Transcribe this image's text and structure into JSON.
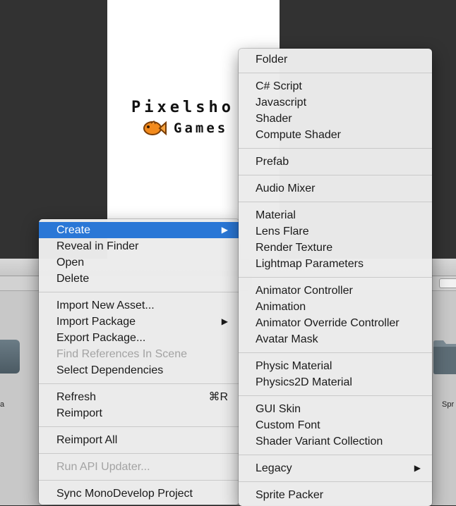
{
  "logo": {
    "line1": "Pixelsho",
    "line2": "Games"
  },
  "asset_labels": {
    "left": "a",
    "right": "Spr"
  },
  "context_menu": {
    "groups": [
      [
        {
          "label": "Create",
          "submenu": true,
          "highlighted": true
        },
        {
          "label": "Reveal in Finder"
        },
        {
          "label": "Open"
        },
        {
          "label": "Delete"
        }
      ],
      [
        {
          "label": "Import New Asset..."
        },
        {
          "label": "Import Package",
          "submenu": true
        },
        {
          "label": "Export Package..."
        },
        {
          "label": "Find References In Scene",
          "disabled": true
        },
        {
          "label": "Select Dependencies"
        }
      ],
      [
        {
          "label": "Refresh",
          "shortcut": "⌘R"
        },
        {
          "label": "Reimport"
        }
      ],
      [
        {
          "label": "Reimport All"
        }
      ],
      [
        {
          "label": "Run API Updater...",
          "disabled": true
        }
      ],
      [
        {
          "label": "Sync MonoDevelop Project"
        }
      ]
    ]
  },
  "create_submenu": {
    "groups": [
      [
        {
          "label": "Folder"
        }
      ],
      [
        {
          "label": "C# Script"
        },
        {
          "label": "Javascript"
        },
        {
          "label": "Shader"
        },
        {
          "label": "Compute Shader"
        }
      ],
      [
        {
          "label": "Prefab"
        }
      ],
      [
        {
          "label": "Audio Mixer"
        }
      ],
      [
        {
          "label": "Material"
        },
        {
          "label": "Lens Flare"
        },
        {
          "label": "Render Texture"
        },
        {
          "label": "Lightmap Parameters"
        }
      ],
      [
        {
          "label": "Animator Controller"
        },
        {
          "label": "Animation"
        },
        {
          "label": "Animator Override Controller"
        },
        {
          "label": "Avatar Mask"
        }
      ],
      [
        {
          "label": "Physic Material"
        },
        {
          "label": "Physics2D Material"
        }
      ],
      [
        {
          "label": "GUI Skin"
        },
        {
          "label": "Custom Font"
        },
        {
          "label": "Shader Variant Collection"
        }
      ],
      [
        {
          "label": "Legacy",
          "submenu": true
        }
      ],
      [
        {
          "label": "Sprite Packer"
        }
      ]
    ]
  },
  "icons": {
    "submenu_arrow": "triangle-right-icon",
    "logo_fish": "fish-icon",
    "folder": "folder-icon"
  },
  "colors": {
    "highlight": "#2a77d6",
    "disabled_text": "#a3a3a3",
    "menu_bg": "#ececec"
  }
}
